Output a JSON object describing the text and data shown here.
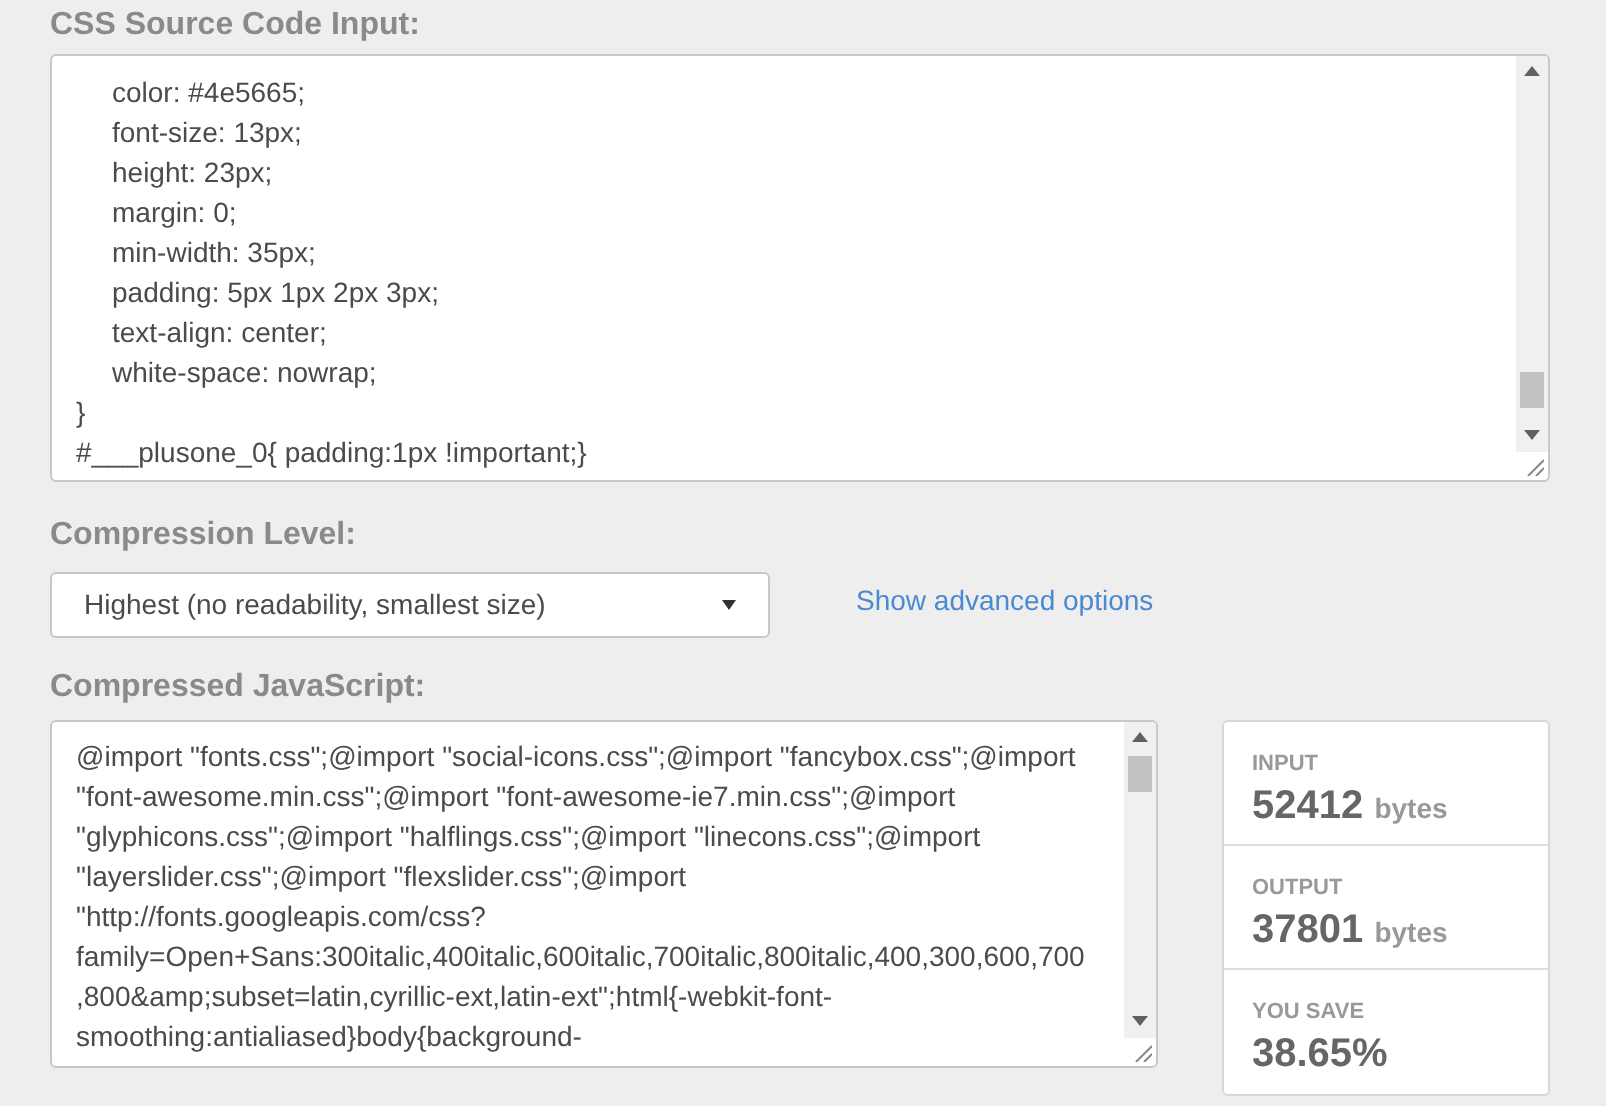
{
  "source_input": {
    "heading": "CSS Source Code Input:",
    "lines": [
      {
        "kind": "declaration",
        "text": "color: #4e5665;"
      },
      {
        "kind": "declaration",
        "text": "font-size: 13px;"
      },
      {
        "kind": "declaration",
        "text": "height: 23px;"
      },
      {
        "kind": "declaration",
        "text": "margin: 0;"
      },
      {
        "kind": "declaration",
        "text": "min-width: 35px;"
      },
      {
        "kind": "declaration",
        "text": "padding: 5px 1px 2px 3px;"
      },
      {
        "kind": "declaration",
        "text": "text-align: center;"
      },
      {
        "kind": "declaration",
        "text": "white-space: nowrap;"
      },
      {
        "kind": "rule",
        "text": "}"
      },
      {
        "kind": "rule",
        "text": "#___plusone_0{ padding:1px !important;}"
      }
    ]
  },
  "compression": {
    "heading": "Compression Level:",
    "value": "Highest (no readability, smallest size)",
    "link": "Show advanced options"
  },
  "output": {
    "heading": "Compressed JavaScript:",
    "lines": [
      "@import \"fonts.css\";@import \"social-icons.css\";@import \"fancybox.css\";@import",
      "\"font-awesome.min.css\";@import \"font-awesome-ie7.min.css\";@import",
      "\"glyphicons.css\";@import \"halflings.css\";@import \"linecons.css\";@import",
      "\"layerslider.css\";@import \"flexslider.css\";@import",
      "\"http://fonts.googleapis.com/css?",
      "family=Open+Sans:300italic,400italic,600italic,700italic,800italic,400,300,600,700",
      ",800&amp;subset=latin,cyrillic-ext,latin-ext\";html{-webkit-font-",
      "smoothing:antialiased}body{background-"
    ]
  },
  "stats": [
    {
      "label": "INPUT",
      "value": "52412",
      "unit": "bytes"
    },
    {
      "label": "OUTPUT",
      "value": "37801",
      "unit": "bytes"
    },
    {
      "label": "YOU SAVE",
      "value": "38.65%"
    }
  ]
}
